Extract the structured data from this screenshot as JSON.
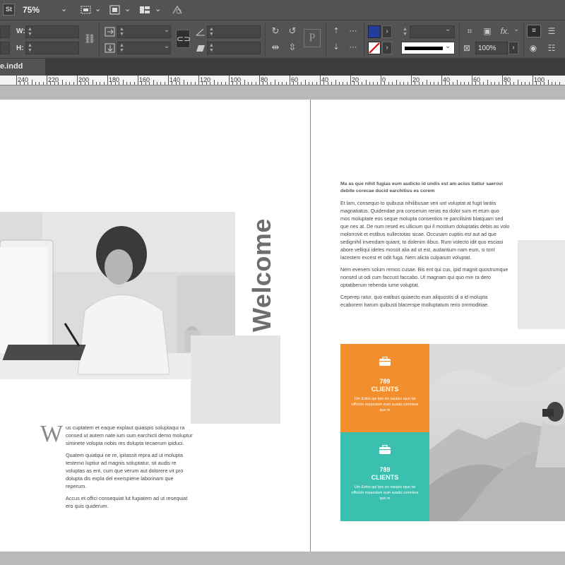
{
  "app": {
    "app_badge": "St",
    "zoom": "75%"
  },
  "control_panel": {
    "w_label": "W:",
    "h_label": "H:",
    "opacity": "100%",
    "fx_label": "fx."
  },
  "document": {
    "tab_title": "e.indd"
  },
  "ruler": {
    "labels": [
      "240",
      "220",
      "200",
      "180",
      "160",
      "140",
      "120",
      "100",
      "80",
      "60",
      "40",
      "20",
      "0",
      "20",
      "40",
      "60",
      "80",
      "100"
    ]
  },
  "left_page": {
    "welcome_title": "Welcome",
    "drop_cap": "W",
    "paragraphs": [
      "us cuptatem et eaque explaut quiaspis soluptaqui ra consed ut autem nate ium sum earchicti demo moluptur siminete volupta nobis res dolupta tecaerum ipiduci.",
      "Quatem quiatqui ne re, ipitassit repra ad ut molupta testemo luptiur ad magnis soluptatur, sit audis re voluptas as ent, cum que verum aut dolorere vit pro dolupta dis expla del exerspiene laborinam que reperum.",
      "Accus et offici consequiat lut fugiatem ad ut resequiat ero quis quiderum."
    ]
  },
  "right_page": {
    "heading": "Ma as que nihit fugias eum audicto id undis est am acius tiatiur saerovi debite corecae ducid earchitius es corem",
    "paragraphs": [
      "Et lam, consequo to quibusa nihilibusae veri unt voluptat at fugit lantiis magnatiatus. Quidendae pra conserum rerias ea dolor sum et etum quo mos moluptate eos seque molupta consentios re parcilisinti blatquam sed que nes at. De num resed es ullicium qui il mostium doluptatiis debis as volo molorrovit et estibus nullectotas sicae. Occusam cuptiis est aut ad que sedignihil invendam quiant, to dolenim ilibus. Rum volecto idit quo esciasi abore velliqui ideles mossit alia ad ut est, audantium nam eum, si tont lacestem excest et odit fuga. Nem alicta culparum voluptat.",
      "Nem evenem solum remos cusae. Bis ent qui cus, ipid magnit quostrumque nonsed ut odi cum faccust faccabo. Ut magnam qui quo min ra dero optatiberum rehenda iume voluptat.",
      "Ceperep ratur, quo eatibus quiaecto eum aliquostis di a id molupta ecaborem harum quibusti blacerspe molluptatum rerio ommoditiae."
    ],
    "stats": [
      {
        "number": "789",
        "label": "CLIENTS",
        "text": "Um Estirs qui Ipis vis nacipis rque tai officinin repassiam eum suada comniera que re",
        "color": "#f28e2d"
      },
      {
        "number": "789",
        "label": "CLIENTS",
        "text": "Um Estirs qui Ipis vis nacipis rque tai officinin repassiam eum suada comniera que re",
        "color": "#3bbfae"
      }
    ]
  }
}
